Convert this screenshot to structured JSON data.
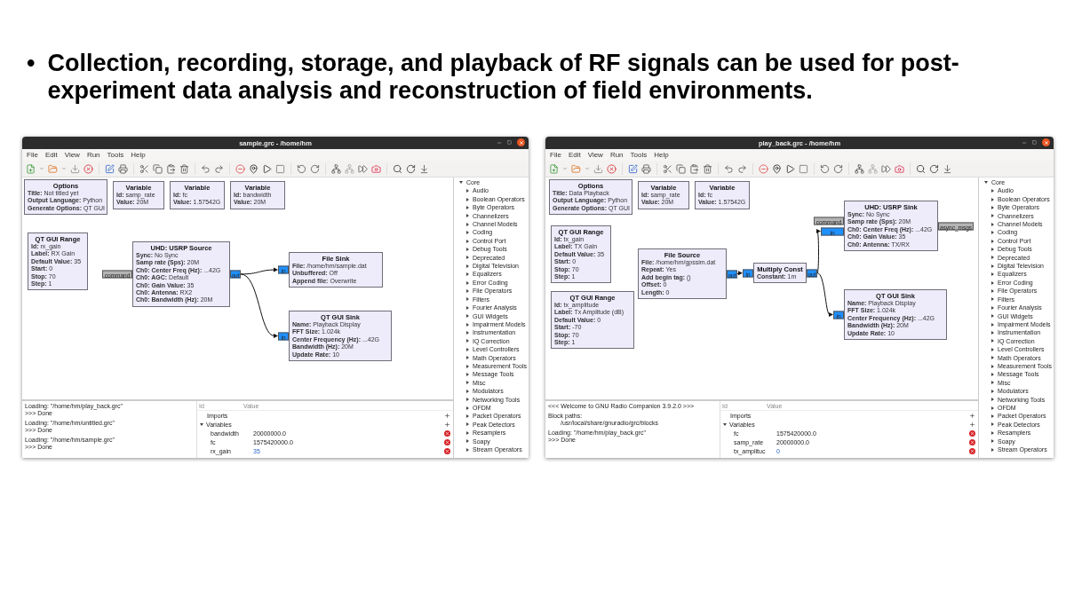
{
  "slide": {
    "bullet": "•",
    "text": "Collection, recording, storage, and playback of RF signals can be used for post-experiment data analysis and reconstruction of field environments."
  },
  "windows": [
    {
      "title": "sample.grc - /home/hm",
      "menu": [
        "File",
        "Edit",
        "View",
        "Run",
        "Tools",
        "Help"
      ],
      "blocks": [
        {
          "title": "Options",
          "params": [
            "**Title:** Not titled yet",
            "**Output Language:** Python",
            "**Generate Options:** QT GUI"
          ]
        },
        {
          "title": "Variable",
          "params": [
            "**Id:** samp_rate",
            "**Value:** 20M"
          ]
        },
        {
          "title": "Variable",
          "params": [
            "**Id:** fc",
            "**Value:** 1.57542G"
          ]
        },
        {
          "title": "Variable",
          "params": [
            "**Id:** bandwidth",
            "**Value:** 20M"
          ]
        },
        {
          "title": "QT GUI Range",
          "params": [
            "**Id:** rx_gain",
            "**Label:** RX Gain",
            "**Default Value:** 35",
            "**Start:** 0",
            "**Stop:** 70",
            "**Step:** 1"
          ]
        },
        {
          "title": "UHD: USRP Source",
          "params": [
            "**Sync:** No Sync",
            "**Samp rate (Sps):** 20M",
            "**Ch0: Center Freq (Hz):** ...42G",
            "**Ch0: AGC:** Default",
            "**Ch0: Gain Value:** 35",
            "**Ch0: Antenna:** RX2",
            "**Ch0: Bandwidth (Hz):** 20M"
          ],
          "ports": [
            {
              "label": "command",
              "kind": "message_in"
            },
            {
              "label": "out",
              "kind": "stream_out"
            }
          ]
        },
        {
          "title": "File Sink",
          "params": [
            "**File:** /home/hm/sample.dat",
            "**Unbuffered:** Off",
            "**Append file:** Overwrite"
          ],
          "ports": [
            {
              "label": "in",
              "kind": "stream_in"
            }
          ]
        },
        {
          "title": "QT GUI Sink",
          "params": [
            "**Name:** Playback Display",
            "**FFT Size:** 1.024k",
            "**Center Frequency (Hz):** ...42G",
            "**Bandwidth (Hz):** 20M",
            "**Update Rate:** 10"
          ],
          "ports": [
            {
              "label": "in",
              "kind": "stream_in"
            }
          ]
        }
      ],
      "console": [
        [
          {
            "text": "Loading: \"/home/hm/play_back.grc\"",
            "kind": "plain"
          },
          {
            "text": ">>> Done",
            "kind": "plain"
          }
        ],
        [
          {
            "text": "Loading: \"/home/hm/untitled.grc\"",
            "kind": "plain"
          },
          {
            "text": ">>> Done",
            "kind": "plain"
          }
        ],
        [
          {
            "text": "Loading: \"/home/hm/sample.grc\"",
            "kind": "plain"
          },
          {
            "text": ">>> Done",
            "kind": "plain"
          }
        ]
      ],
      "variables": {
        "columns": [
          "Id",
          "Value"
        ],
        "rows": [
          {
            "name": "Imports"
          },
          {
            "name": "Variables",
            "expanded": true,
            "children": [
              {
                "name": "bandwidth",
                "value": "20000000.0",
                "kind": "literal"
              },
              {
                "name": "fc",
                "value": "1575420000.0",
                "kind": "literal"
              },
              {
                "name": "rx_gain",
                "value": "35",
                "kind": "expression"
              }
            ]
          }
        ]
      },
      "library": {
        "name": "Core",
        "expanded": true,
        "children": [
          {
            "name": "Audio",
            "expanded": false
          },
          {
            "name": "Boolean Operators",
            "expanded": false
          },
          {
            "name": "Byte Operators",
            "expanded": false
          },
          {
            "name": "Channelizers",
            "expanded": false
          },
          {
            "name": "Channel Models",
            "expanded": false
          },
          {
            "name": "Coding",
            "expanded": false
          },
          {
            "name": "Control Port",
            "expanded": false
          },
          {
            "name": "Debug Tools",
            "expanded": false
          },
          {
            "name": "Deprecated",
            "expanded": false
          },
          {
            "name": "Digital Television",
            "expanded": false
          },
          {
            "name": "Equalizers",
            "expanded": false
          },
          {
            "name": "Error Coding",
            "expanded": false
          },
          {
            "name": "File Operators",
            "expanded": false
          },
          {
            "name": "Filters",
            "expanded": false
          },
          {
            "name": "Fourier Analysis",
            "expanded": false
          },
          {
            "name": "GUI Widgets",
            "expanded": false
          },
          {
            "name": "Impairment Models",
            "expanded": false
          },
          {
            "name": "Instrumentation",
            "expanded": false
          },
          {
            "name": "IQ Correction",
            "expanded": false
          },
          {
            "name": "Level Controllers",
            "expanded": false
          },
          {
            "name": "Math Operators",
            "expanded": false
          },
          {
            "name": "Measurement Tools",
            "expanded": false
          },
          {
            "name": "Message Tools",
            "expanded": false
          },
          {
            "name": "Misc",
            "expanded": false
          },
          {
            "name": "Modulators",
            "expanded": false
          },
          {
            "name": "Networking Tools",
            "expanded": false
          },
          {
            "name": "OFDM",
            "expanded": false
          },
          {
            "name": "Packet Operators",
            "expanded": false
          },
          {
            "name": "Peak Detectors",
            "expanded": false
          },
          {
            "name": "Resamplers",
            "expanded": false
          },
          {
            "name": "Soapy",
            "expanded": false
          },
          {
            "name": "Stream Operators",
            "expanded": false
          }
        ]
      }
    },
    {
      "title": "play_back.grc - /home/hm",
      "menu": [
        "File",
        "Edit",
        "View",
        "Run",
        "Tools",
        "Help"
      ],
      "blocks": [
        {
          "title": "Options",
          "params": [
            "**Title:** Data Playback",
            "**Output Language:** Python",
            "**Generate Options:** QT GUI"
          ]
        },
        {
          "title": "Variable",
          "params": [
            "**Id:** samp_rate",
            "**Value:** 20M"
          ]
        },
        {
          "title": "Variable",
          "params": [
            "**Id:** fc",
            "**Value:** 1.57542G"
          ]
        },
        {
          "title": "QT GUI Range",
          "params": [
            "**Id:** tx_gain",
            "**Label:** TX Gain",
            "**Default Value:** 35",
            "**Start:** 0",
            "**Stop:** 70",
            "**Step:** 1"
          ]
        },
        {
          "title": "QT GUI Range",
          "params": [
            "**Id:** tx_amplitude",
            "**Label:** Tx Amplitude (dB)",
            "**Default Value:** 0",
            "**Start:** -70",
            "**Stop:** 70",
            "**Step:** 1"
          ]
        },
        {
          "title": "File Source",
          "params": [
            "**File:** /home/hm/gpssim.dat",
            "**Repeat:** Yes",
            "**Add begin tag:** ()",
            "**Offset:** 0",
            "**Length:** 0"
          ],
          "ports": [
            {
              "label": "out",
              "kind": "stream_out"
            }
          ]
        },
        {
          "title": "Multiply Const",
          "params": [
            "**Constant:** 1m"
          ],
          "ports": [
            {
              "label": "in",
              "kind": "stream_in"
            },
            {
              "label": "out",
              "kind": "stream_out"
            }
          ]
        },
        {
          "title": "UHD: USRP Sink",
          "params": [
            "**Sync:** No Sync",
            "**Samp rate (Sps):** 20M",
            "**Ch0: Center Freq (Hz):** ...42G",
            "**Ch0: Gain Value:** 35",
            "**Ch0: Antenna:** TX/RX"
          ],
          "ports": [
            {
              "label": "command",
              "kind": "message_in"
            },
            {
              "label": "in",
              "kind": "stream_in"
            },
            {
              "label": "async_msgs",
              "kind": "message_out"
            }
          ]
        },
        {
          "title": "QT GUI Sink",
          "params": [
            "**Name:** Playback Display",
            "**FFT Size:** 1.024k",
            "**Center Frequency (Hz):** ...42G",
            "**Bandwidth (Hz):** 20M",
            "**Update Rate:** 10"
          ],
          "ports": [
            {
              "label": "in",
              "kind": "stream_in"
            }
          ]
        }
      ],
      "console": [
        [
          {
            "text": "<<< Welcome to GNU Radio Companion 3.9.2.0 >>>",
            "kind": "plain"
          }
        ],
        [
          {
            "text": "Block paths:",
            "kind": "plain"
          },
          {
            "text": "/usr/local/share/gnuradio/grc/blocks",
            "kind": "path"
          }
        ],
        [
          {
            "text": "Loading: \"/home/hm/play_back.grc\"",
            "kind": "plain"
          },
          {
            "text": ">>> Done",
            "kind": "plain"
          }
        ]
      ],
      "variables": {
        "columns": [
          "Id",
          "Value"
        ],
        "rows": [
          {
            "name": "Imports"
          },
          {
            "name": "Variables",
            "expanded": true,
            "children": [
              {
                "name": "fc",
                "value": "1575420000.0",
                "kind": "literal"
              },
              {
                "name": "samp_rate",
                "value": "20000000.0",
                "kind": "literal"
              },
              {
                "name": "tx_amplituc",
                "value": "0",
                "kind": "expression"
              }
            ]
          }
        ]
      },
      "library": {
        "name": "Core",
        "expanded": true,
        "children": [
          {
            "name": "Audio",
            "expanded": false
          },
          {
            "name": "Boolean Operators",
            "expanded": false
          },
          {
            "name": "Byte Operators",
            "expanded": false
          },
          {
            "name": "Channelizers",
            "expanded": false
          },
          {
            "name": "Channel Models",
            "expanded": false
          },
          {
            "name": "Coding",
            "expanded": false
          },
          {
            "name": "Control Port",
            "expanded": false
          },
          {
            "name": "Debug Tools",
            "expanded": false
          },
          {
            "name": "Deprecated",
            "expanded": false
          },
          {
            "name": "Digital Television",
            "expanded": false
          },
          {
            "name": "Equalizers",
            "expanded": false
          },
          {
            "name": "Error Coding",
            "expanded": false
          },
          {
            "name": "File Operators",
            "expanded": false
          },
          {
            "name": "Filters",
            "expanded": false
          },
          {
            "name": "Fourier Analysis",
            "expanded": false
          },
          {
            "name": "GUI Widgets",
            "expanded": false
          },
          {
            "name": "Impairment Models",
            "expanded": false
          },
          {
            "name": "Instrumentation",
            "expanded": false
          },
          {
            "name": "IQ Correction",
            "expanded": false
          },
          {
            "name": "Level Controllers",
            "expanded": false
          },
          {
            "name": "Math Operators",
            "expanded": false
          },
          {
            "name": "Measurement Tools",
            "expanded": false
          },
          {
            "name": "Message Tools",
            "expanded": false
          },
          {
            "name": "Misc",
            "expanded": false
          },
          {
            "name": "Modulators",
            "expanded": false
          },
          {
            "name": "Networking Tools",
            "expanded": false
          },
          {
            "name": "OFDM",
            "expanded": false
          },
          {
            "name": "Packet Operators",
            "expanded": false
          },
          {
            "name": "Peak Detectors",
            "expanded": false
          },
          {
            "name": "Resamplers",
            "expanded": false
          },
          {
            "name": "Soapy",
            "expanded": false
          },
          {
            "name": "Stream Operators",
            "expanded": false
          }
        ]
      }
    }
  ]
}
